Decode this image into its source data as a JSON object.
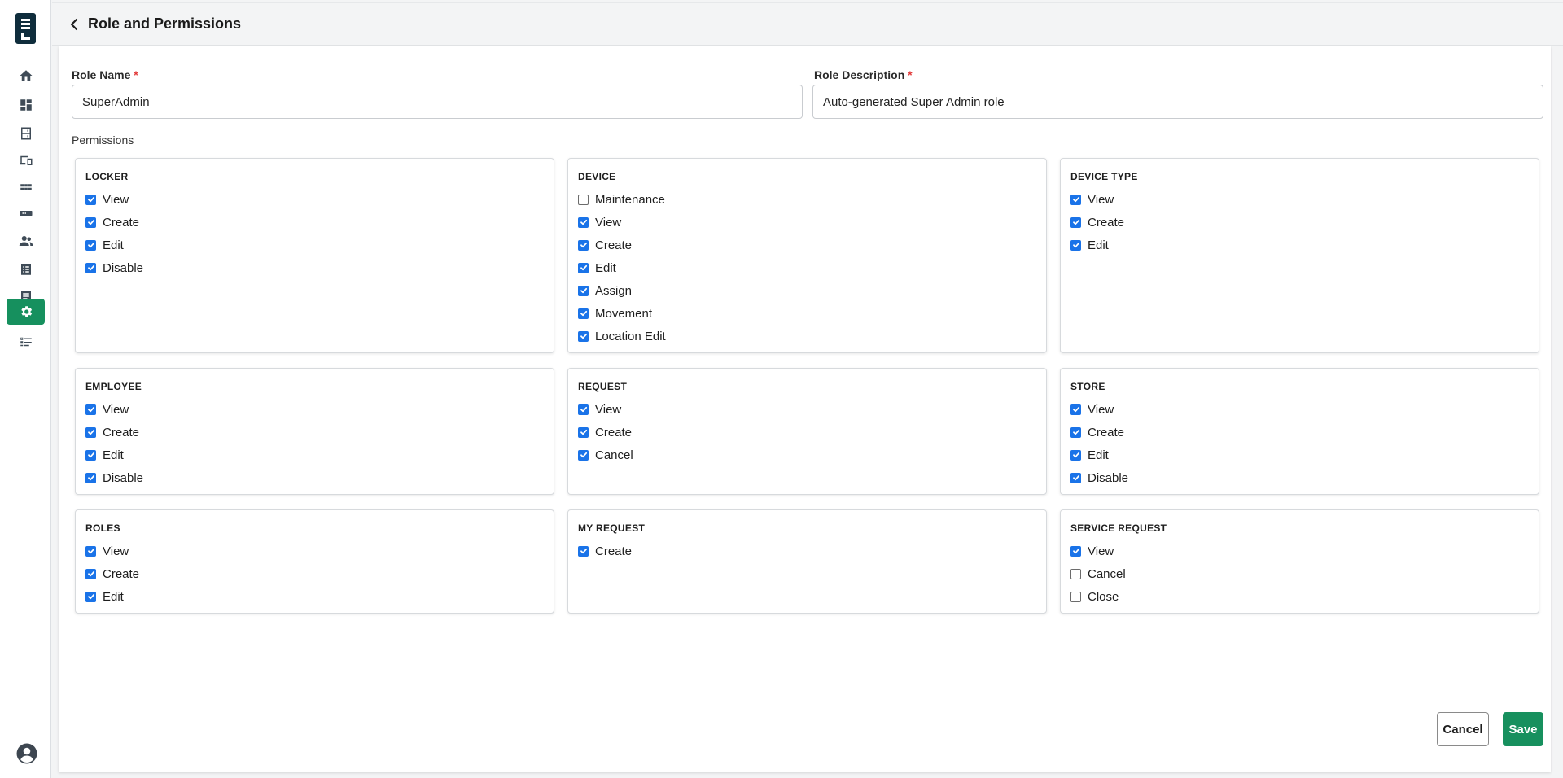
{
  "header": {
    "title": "Role and Permissions"
  },
  "form": {
    "role_name_label": "Role Name",
    "role_name_value": "SuperAdmin",
    "role_desc_label": "Role Description",
    "role_desc_value": "Auto-generated Super Admin role",
    "required_mark": "*",
    "permissions_label": "Permissions"
  },
  "cards": [
    {
      "title": "LOCKER",
      "items": [
        {
          "label": "View",
          "checked": true
        },
        {
          "label": "Create",
          "checked": true
        },
        {
          "label": "Edit",
          "checked": true
        },
        {
          "label": "Disable",
          "checked": true
        }
      ]
    },
    {
      "title": "DEVICE",
      "items": [
        {
          "label": "Maintenance",
          "checked": false
        },
        {
          "label": "View",
          "checked": true
        },
        {
          "label": "Create",
          "checked": true
        },
        {
          "label": "Edit",
          "checked": true
        },
        {
          "label": "Assign",
          "checked": true
        },
        {
          "label": "Movement",
          "checked": true
        },
        {
          "label": "Location Edit",
          "checked": true
        }
      ]
    },
    {
      "title": "DEVICE TYPE",
      "items": [
        {
          "label": "View",
          "checked": true
        },
        {
          "label": "Create",
          "checked": true
        },
        {
          "label": "Edit",
          "checked": true
        }
      ]
    },
    {
      "title": "EMPLOYEE",
      "items": [
        {
          "label": "View",
          "checked": true
        },
        {
          "label": "Create",
          "checked": true
        },
        {
          "label": "Edit",
          "checked": true
        },
        {
          "label": "Disable",
          "checked": true
        }
      ]
    },
    {
      "title": "REQUEST",
      "items": [
        {
          "label": "View",
          "checked": true
        },
        {
          "label": "Create",
          "checked": true
        },
        {
          "label": "Cancel",
          "checked": true
        }
      ]
    },
    {
      "title": "STORE",
      "items": [
        {
          "label": "View",
          "checked": true
        },
        {
          "label": "Create",
          "checked": true
        },
        {
          "label": "Edit",
          "checked": true
        },
        {
          "label": "Disable",
          "checked": true
        }
      ]
    },
    {
      "title": "ROLES",
      "items": [
        {
          "label": "View",
          "checked": true
        },
        {
          "label": "Create",
          "checked": true
        },
        {
          "label": "Edit",
          "checked": true
        }
      ]
    },
    {
      "title": "MY REQUEST",
      "items": [
        {
          "label": "Create",
          "checked": true
        }
      ]
    },
    {
      "title": "SERVICE REQUEST",
      "items": [
        {
          "label": "View",
          "checked": true
        },
        {
          "label": "Cancel",
          "checked": false
        },
        {
          "label": "Close",
          "checked": false
        }
      ]
    }
  ],
  "actions": {
    "cancel_label": "Cancel",
    "save_label": "Save"
  },
  "sidebar": {
    "items": [
      {
        "icon": "home-icon"
      },
      {
        "icon": "dashboard-icon"
      },
      {
        "icon": "locker-icon"
      },
      {
        "icon": "devices-icon"
      },
      {
        "icon": "apps-grid-icon"
      },
      {
        "icon": "device-type-icon"
      },
      {
        "icon": "people-icon"
      },
      {
        "icon": "list-icon"
      },
      {
        "icon": "document-icon"
      },
      {
        "icon": "settings-icon",
        "active": true
      },
      {
        "icon": "checklist-icon"
      }
    ]
  },
  "colors": {
    "accent": "#16905e",
    "checkbox": "#1a73e8",
    "logo": "#0f2d3c"
  }
}
